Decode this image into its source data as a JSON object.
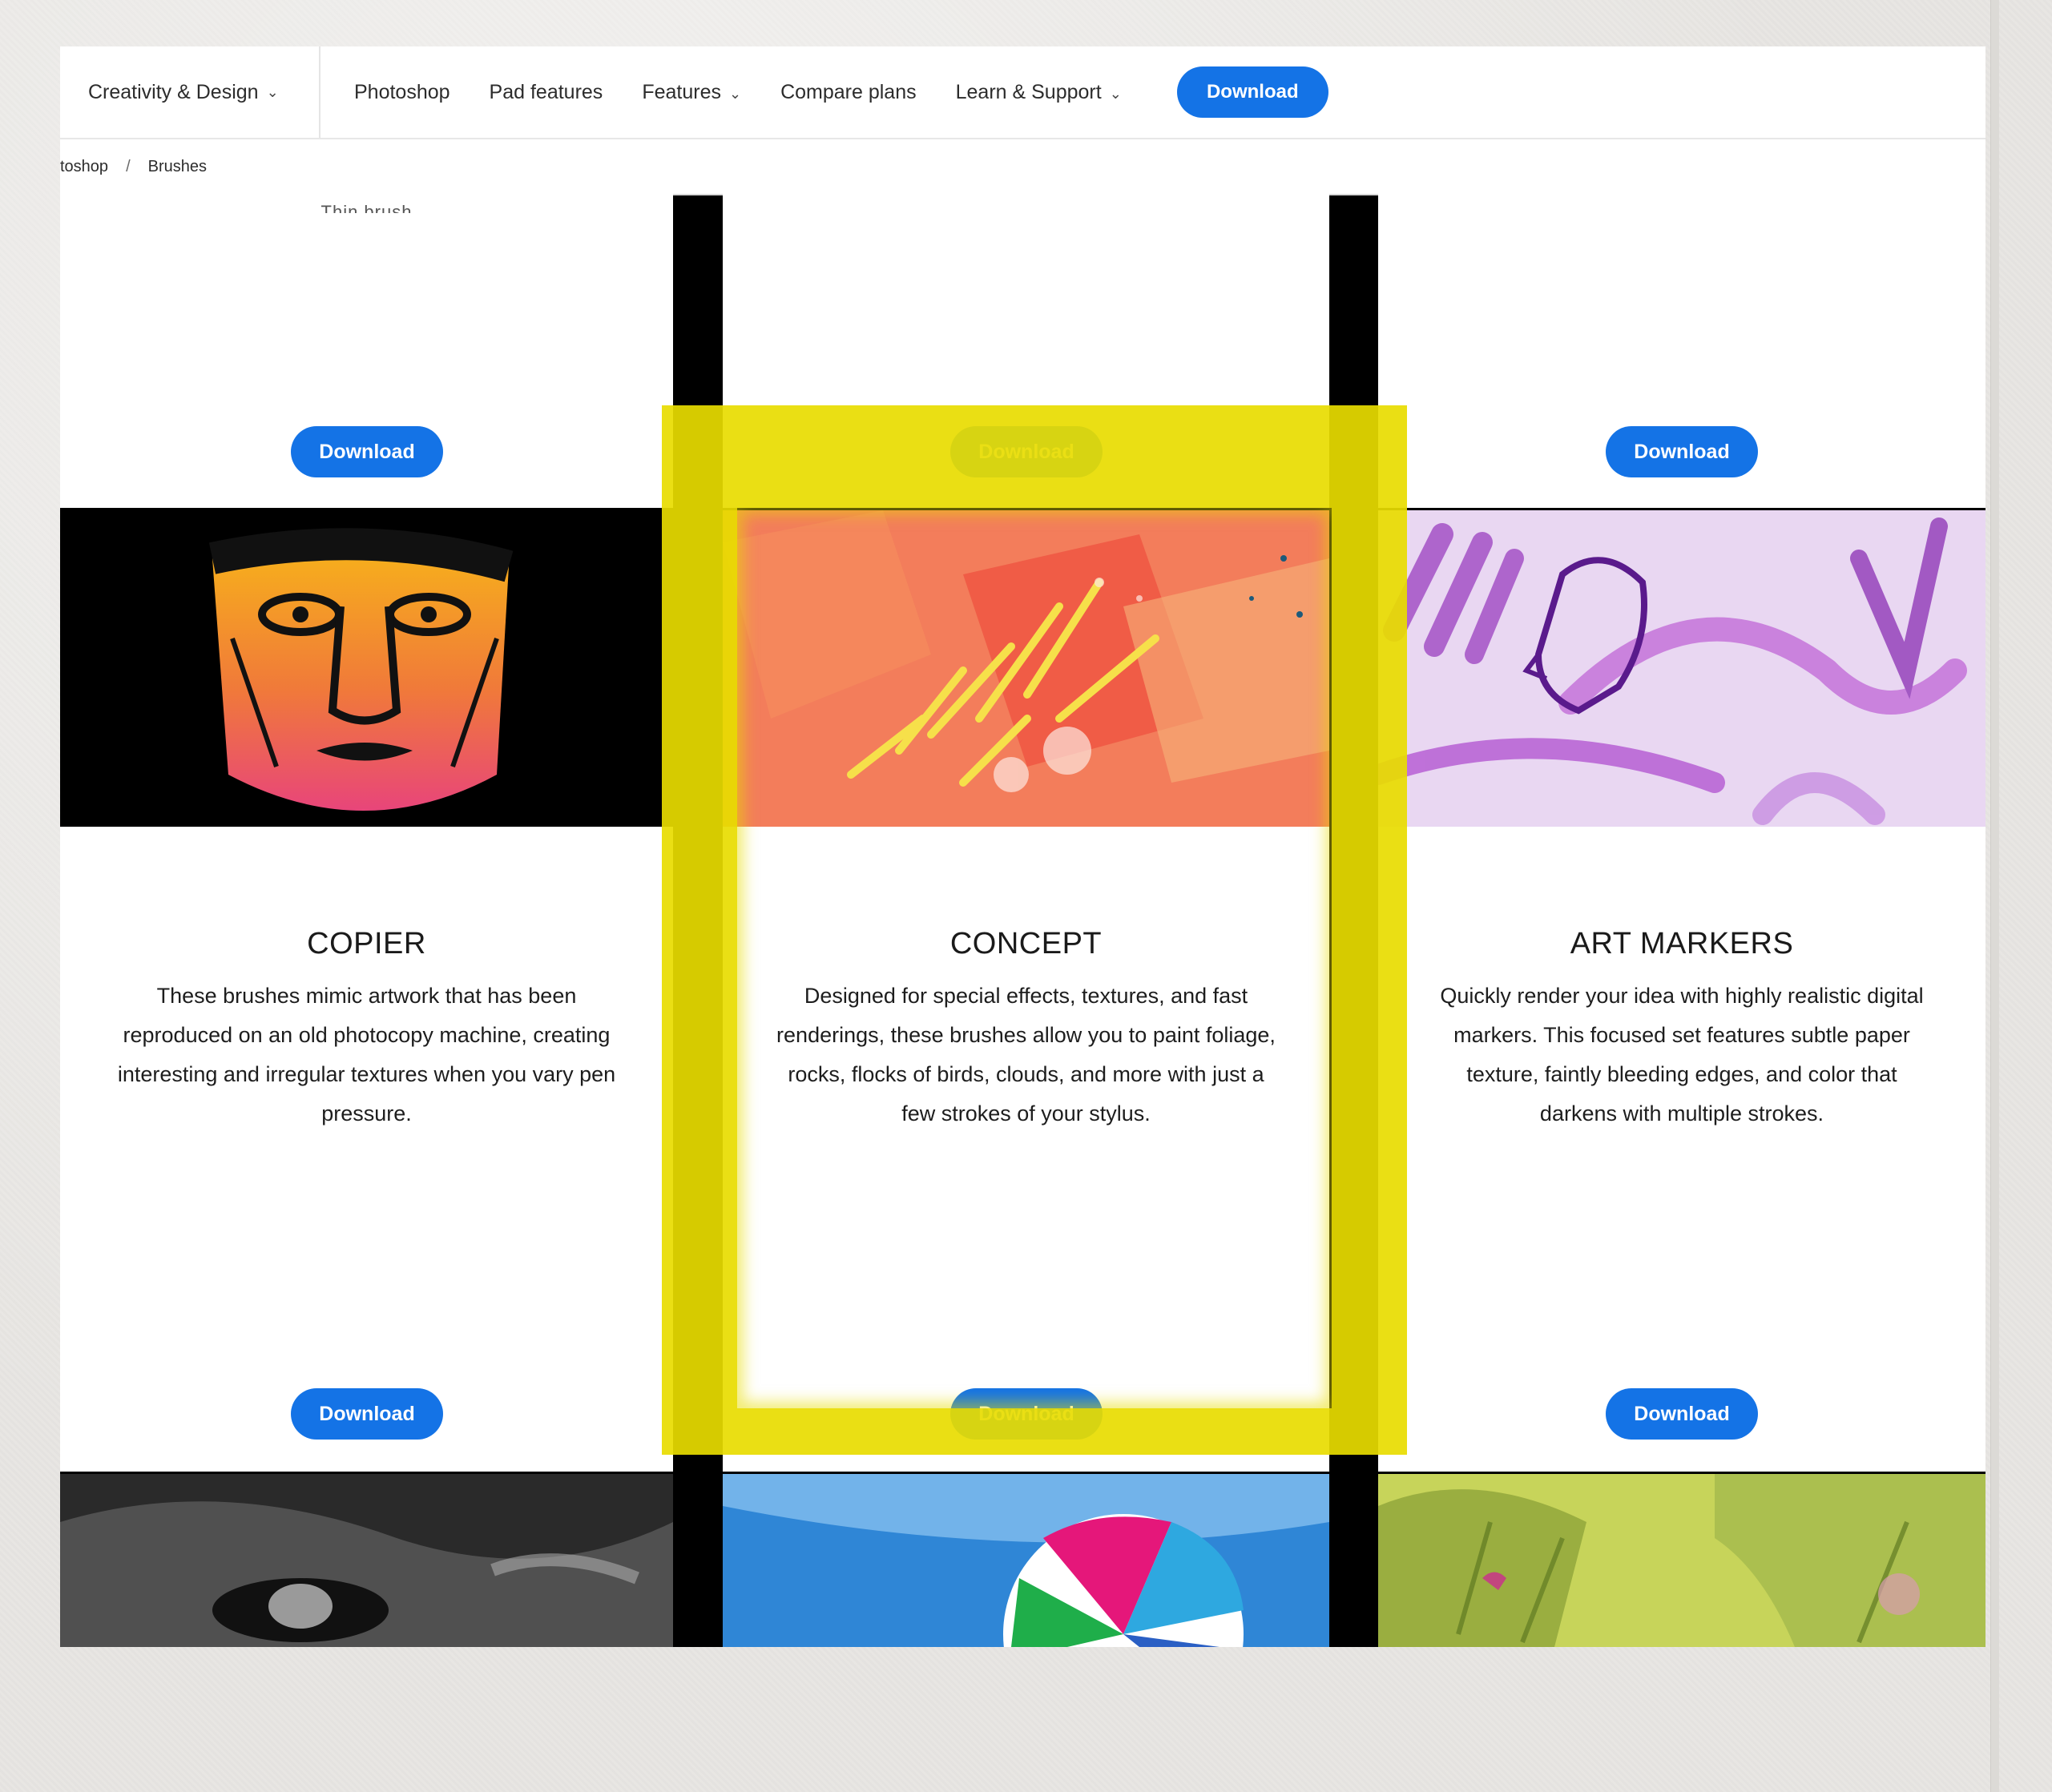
{
  "nav": {
    "brand_menu": "Creativity & Design",
    "links": [
      "Photoshop",
      "Pad features",
      "Features",
      "Compare plans",
      "Learn & Support"
    ],
    "download": "Download"
  },
  "breadcrumb": {
    "parent": "toshop",
    "separator": "/",
    "current": "Brushes"
  },
  "top_row": {
    "download": "Download",
    "ghost_label": "Thin brush"
  },
  "cards": [
    {
      "title": "COPIER",
      "description": "These brushes mimic artwork that has been reproduced on an old photocopy machine, creating interesting and irregular textures when you vary pen pressure.",
      "download": "Download"
    },
    {
      "title": "CONCEPT",
      "description": "Designed for special effects, textures, and fast renderings, these brushes allow you to paint foliage, rocks, flocks of birds, clouds, and more with just a few strokes of your stylus.",
      "download": "Download"
    },
    {
      "title": "ART MARKERS",
      "description": "Quickly render your idea with highly realistic digital markers. This focused set features subtle paper texture, faintly bleeding edges, and color that darkens with multiple strokes.",
      "download": "Download"
    }
  ],
  "colors": {
    "accent": "#1473e6",
    "highlight": "#e8dc00"
  },
  "icons": {
    "chevron": "chevron-down-icon"
  }
}
